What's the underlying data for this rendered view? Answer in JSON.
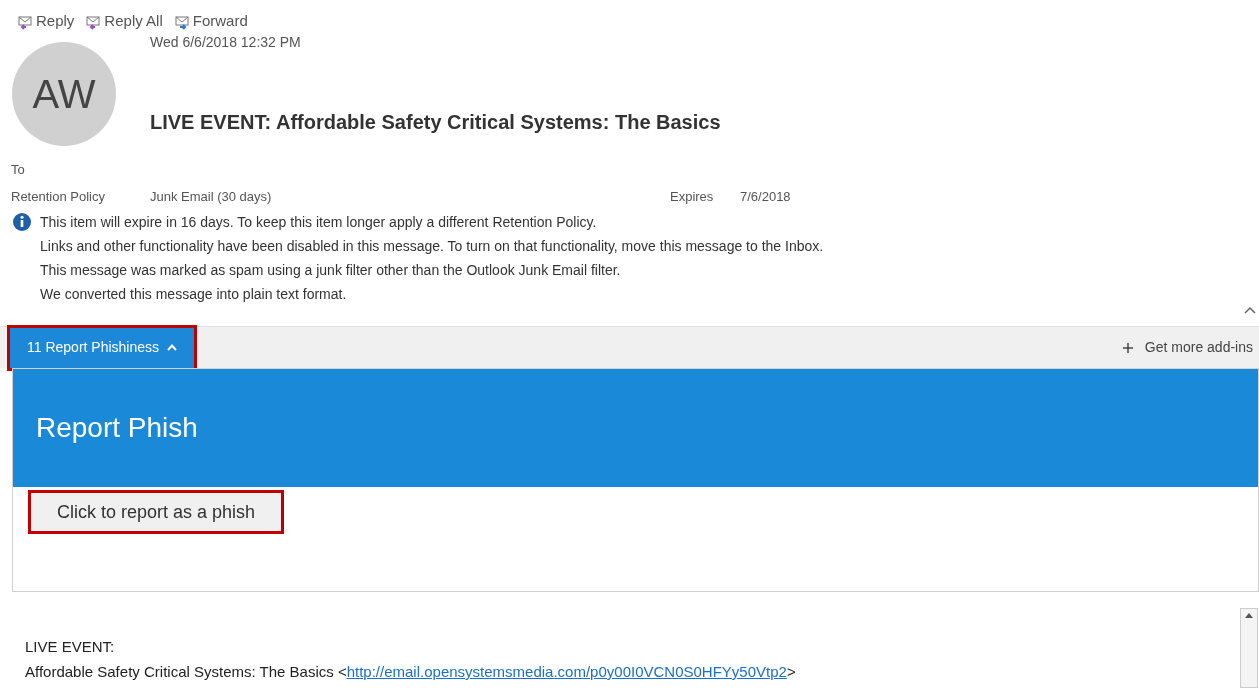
{
  "toolbar": [
    {
      "label": "Reply",
      "kind": "reply"
    },
    {
      "label": "Reply All",
      "kind": "reply_all"
    },
    {
      "label": "Forward",
      "kind": "forward"
    }
  ],
  "message": {
    "date": "Wed 6/6/2018 12:32 PM",
    "avatar": "AW",
    "subject": "LIVE EVENT: Affordable Safety Critical Systems: The Basics",
    "to_label": "To",
    "retention_label": "Retention Policy",
    "retention_value": "Junk Email (30 days)",
    "expires_label": "Expires",
    "expires_value": "7/6/2018"
  },
  "info_lines": [
    "This item will expire in 16 days. To keep this item longer apply a different Retention Policy.",
    "Links and other functionality have been disabled in this message. To turn on that functionality, move this message to the Inbox.",
    "This message was marked as spam using a junk filter other than the Outlook Junk Email filter.",
    "We converted this message into plain text format."
  ],
  "addin_bar": {
    "tab": {
      "label": "11 Report Phishiness",
      "expanded": true,
      "selected": true,
      "highlighted": true
    },
    "get_more": "Get more add-ins"
  },
  "addin_panel": {
    "title": "Report Phish",
    "button": {
      "label": "Click to report as a phish",
      "highlighted": true
    }
  },
  "body": {
    "line_1": "LIVE EVENT:",
    "line_2": {
      "text": "Affordable Safety Critical Systems: The Basics <",
      "link": "http://email.opensystemsmedia.com/p0y00I0VCN0S0HFYy50Vtp2",
      "suffix": ">"
    }
  }
}
